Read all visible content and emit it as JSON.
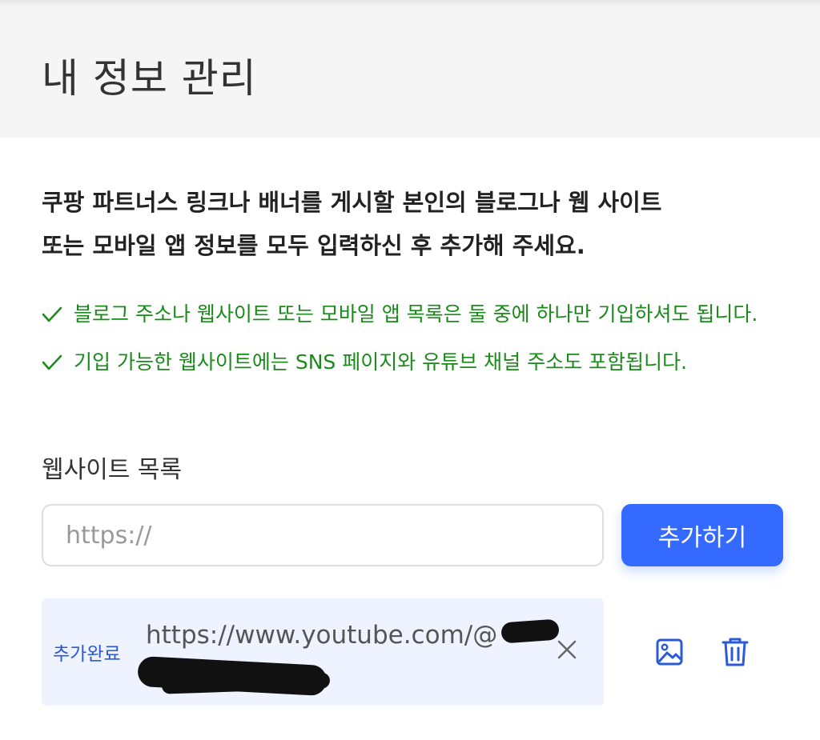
{
  "header": {
    "title": "내 정보 관리"
  },
  "intro": {
    "line1": "쿠팡 파트너스 링크나 배너를 게시할 본인의 블로그나 웹 사이트",
    "line2": "또는 모바일 앱 정보를 모두 입력하신 후 추가해 주세요."
  },
  "notes": [
    {
      "text": "블로그 주소나 웹사이트 또는 모바일 앱 목록은 둘 중에 하나만 기입하셔도 됩니다.",
      "icon": "check-icon"
    },
    {
      "text": "기입 가능한 웹사이트에는 SNS 페이지와 유튜브 채널 주소도 포함됩니다.",
      "icon": "check-icon"
    }
  ],
  "website_section": {
    "label": "웹사이트 목록",
    "input_placeholder": "https://",
    "input_value": "",
    "add_button_label": "추가하기"
  },
  "websites": [
    {
      "status": "추가완료",
      "url": "https://www.youtube.com/@",
      "icons": [
        "close-icon",
        "image-icon",
        "trash-icon"
      ]
    }
  ],
  "colors": {
    "accent": "#346aff",
    "note_green": "#1a8a1a",
    "badge_blue": "#2a5ad6",
    "row_bg": "#eef3ff",
    "header_bg": "#f5f5f5"
  }
}
